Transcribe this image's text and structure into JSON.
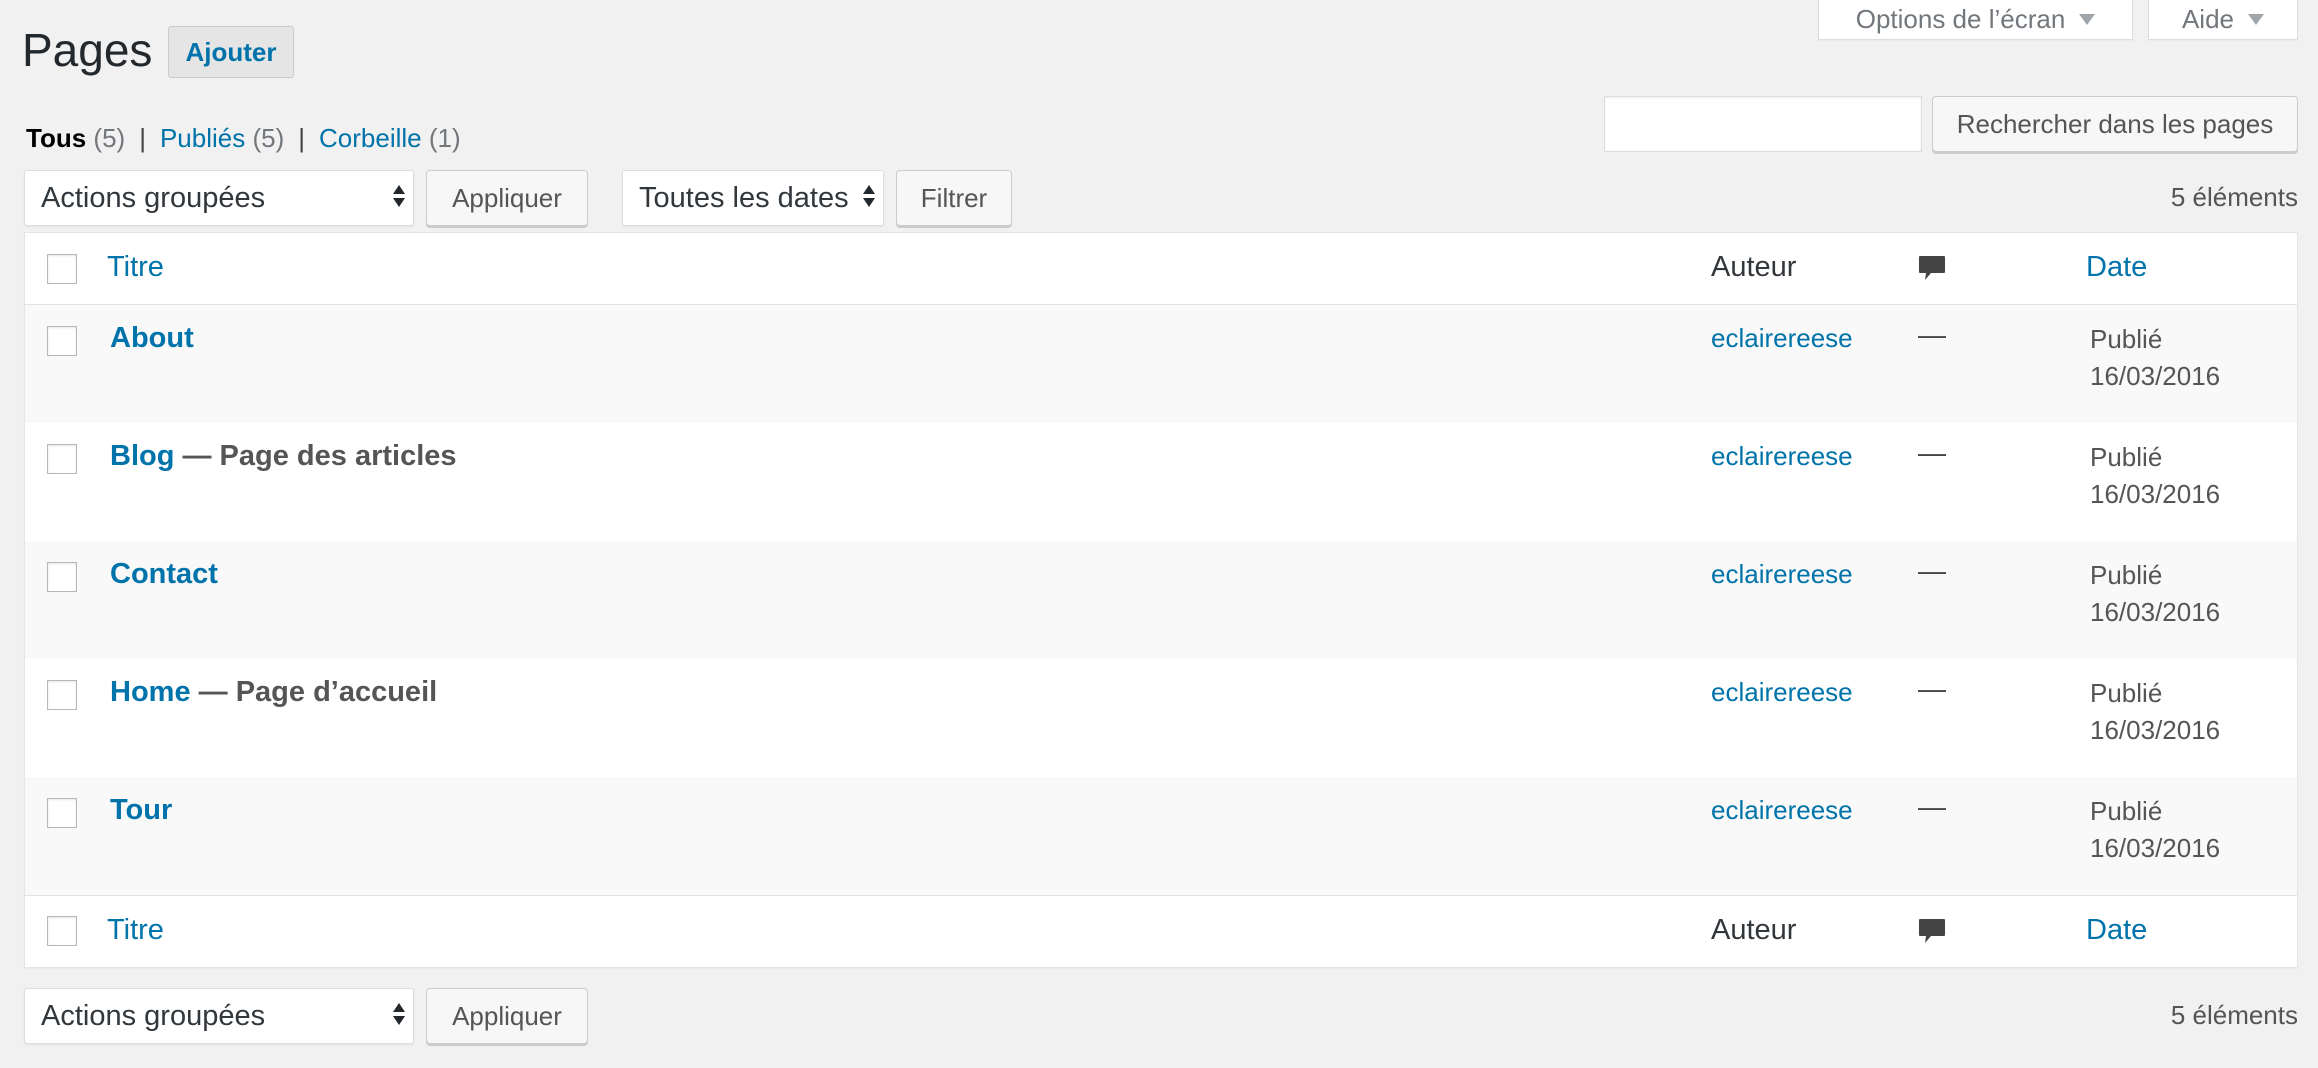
{
  "screen_meta": {
    "screen_options": "Options de l’écran",
    "help": "Aide"
  },
  "header": {
    "title": "Pages",
    "add_new": "Ajouter"
  },
  "filters": {
    "all_label": "Tous",
    "all_count": "(5)",
    "published_label": "Publiés",
    "published_count": "(5)",
    "trash_label": "Corbeille",
    "trash_count": "(1)",
    "separator": "|"
  },
  "search": {
    "placeholder": "",
    "button": "Rechercher dans les pages"
  },
  "tablenav_top": {
    "bulk_actions": "Actions groupées",
    "apply": "Appliquer",
    "dates": "Toutes les dates",
    "filter": "Filtrer",
    "items_count": "5 éléments"
  },
  "tablenav_bottom": {
    "bulk_actions": "Actions groupées",
    "apply": "Appliquer",
    "items_count": "5 éléments"
  },
  "columns": {
    "title": "Titre",
    "author": "Auteur",
    "date": "Date"
  },
  "rows": [
    {
      "title": "About",
      "state": "",
      "author": "eclairereese",
      "comments": "—",
      "status": "Publié",
      "date": "16/03/2016"
    },
    {
      "title": "Blog",
      "state": " — Page des articles",
      "author": "eclairereese",
      "comments": "—",
      "status": "Publié",
      "date": "16/03/2016"
    },
    {
      "title": "Contact",
      "state": "",
      "author": "eclairereese",
      "comments": "—",
      "status": "Publié",
      "date": "16/03/2016"
    },
    {
      "title": "Home",
      "state": " — Page d’accueil",
      "author": "eclairereese",
      "comments": "—",
      "status": "Publié",
      "date": "16/03/2016"
    },
    {
      "title": "Tour",
      "state": "",
      "author": "eclairereese",
      "comments": "—",
      "status": "Publié",
      "date": "16/03/2016"
    }
  ],
  "colors": {
    "link": "#0073aa",
    "background": "#f1f1f1",
    "alt_row": "#f9f9f9"
  }
}
